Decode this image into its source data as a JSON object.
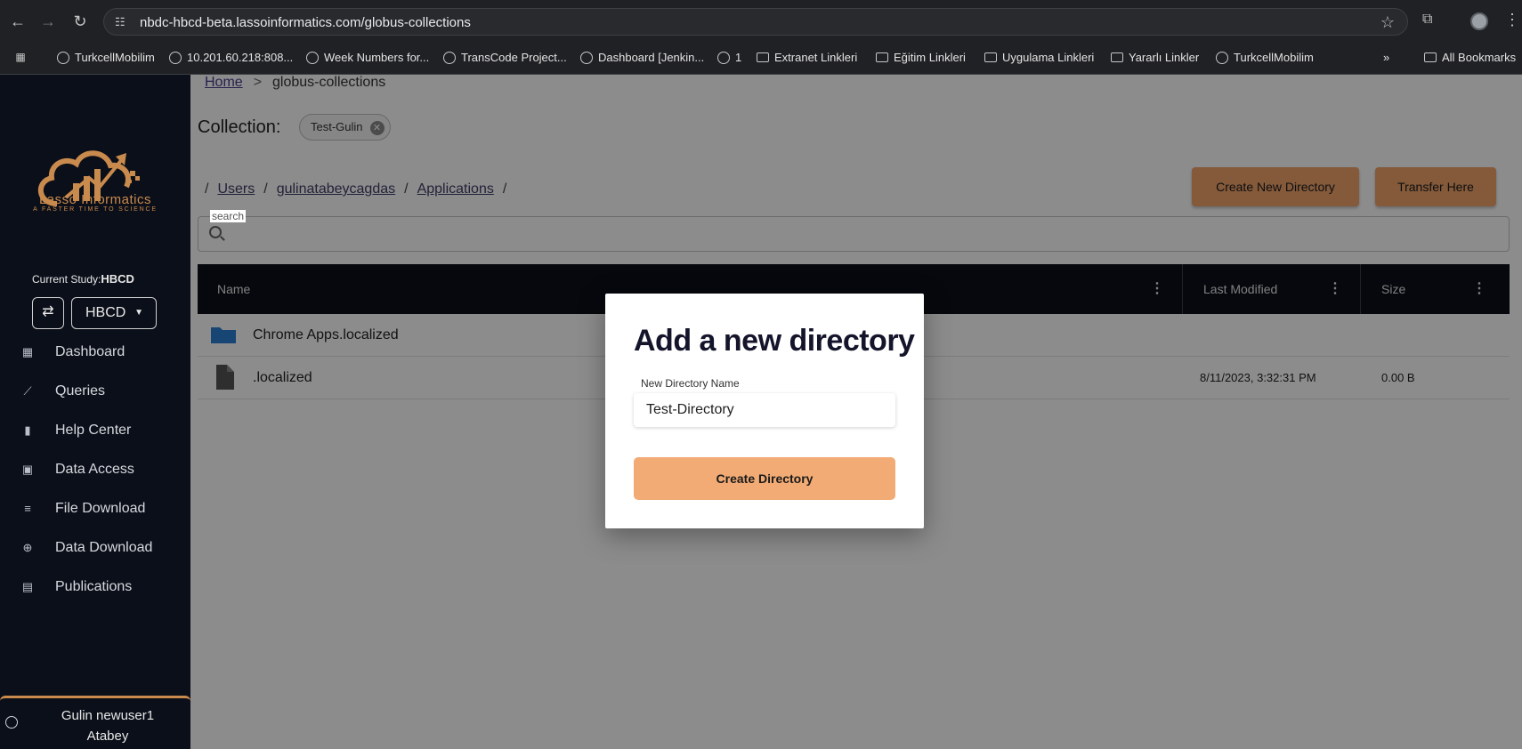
{
  "browser": {
    "url_host": "nbdc-hbcd-beta.lassoinformatics.com",
    "url_path": "/globus-collections",
    "bookmarks": [
      {
        "label": "TurkcellMobilim",
        "icon": "globe-icon"
      },
      {
        "label": "10.201.60.218:808...",
        "icon": "globe-icon"
      },
      {
        "label": "Week Numbers for...",
        "icon": "globe-icon"
      },
      {
        "label": "TransCode Project...",
        "icon": "globe-icon"
      },
      {
        "label": "Dashboard [Jenkin...",
        "icon": "globe-icon"
      },
      {
        "label": "1",
        "icon": "globe-icon"
      },
      {
        "label": "Extranet Linkleri",
        "icon": "folder-icon"
      },
      {
        "label": "Eğitim Linkleri",
        "icon": "folder-icon"
      },
      {
        "label": "Uygulama Linkleri",
        "icon": "folder-icon"
      },
      {
        "label": "Yararlı Linkler",
        "icon": "folder-icon"
      },
      {
        "label": "TurkcellMobilim",
        "icon": "globe-icon"
      }
    ],
    "more_label": "»",
    "all_bookmarks": "All Bookmarks"
  },
  "sidebar": {
    "logo_text": "Lasso Informatics",
    "logo_tagline": "A FASTER TIME TO SCIENCE",
    "current_study_label": "Current Study:",
    "current_study_value": "HBCD",
    "study_select": "HBCD",
    "nav": [
      {
        "label": "Dashboard",
        "icon": "dashboard-icon"
      },
      {
        "label": "Queries",
        "icon": "queries-icon"
      },
      {
        "label": "Help Center",
        "icon": "book-icon"
      },
      {
        "label": "Data Access",
        "icon": "lock-icon"
      },
      {
        "label": "File Download",
        "icon": "list-icon"
      },
      {
        "label": "Data Download",
        "icon": "download-icon"
      },
      {
        "label": "Publications",
        "icon": "document-icon"
      }
    ],
    "user": {
      "line1": "Gulin newuser1",
      "line2": "Atabey"
    }
  },
  "main": {
    "breadcrumb": {
      "home": "Home",
      "sep": ">",
      "current": "globus-collections"
    },
    "collection_label": "Collection:",
    "collection_chip": "Test-Gulin",
    "path": [
      "Users",
      "gulinatabeycagdas",
      "Applications"
    ],
    "buttons": {
      "create_dir": "Create New Directory",
      "transfer": "Transfer Here"
    },
    "search_label": "search",
    "table": {
      "headers": {
        "name": "Name",
        "modified": "Last Modified",
        "size": "Size"
      },
      "rows": [
        {
          "type": "folder",
          "name": "Chrome Apps.localized",
          "modified": "",
          "size": ""
        },
        {
          "type": "file",
          "name": ".localized",
          "modified": "8/11/2023, 3:32:31 PM",
          "size": "0.00 B"
        }
      ]
    }
  },
  "dialog": {
    "title": "Add a new directory",
    "field_label": "New Directory Name",
    "field_value": "Test-Directory",
    "submit": "Create Directory"
  },
  "colors": {
    "accent": "#f2ab74",
    "sidebar_bg": "#0b0f19",
    "brand": "#c98a4e"
  }
}
